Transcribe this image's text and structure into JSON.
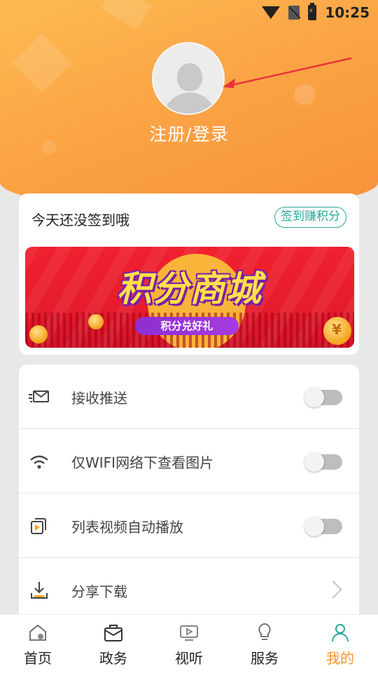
{
  "status_bar": {
    "time": "10:25",
    "icons": [
      "wifi-icon",
      "no-sim-icon",
      "battery-charging-icon"
    ]
  },
  "profile": {
    "avatar_icon": "default-avatar-icon",
    "login_label": "注册/登录"
  },
  "checkin": {
    "prompt": "今天还没签到哦",
    "button_label": "签到赚积分",
    "banner": {
      "title": "积分商城",
      "subtitle": "积分兑好礼"
    }
  },
  "settings": {
    "items": [
      {
        "icon": "mail-icon",
        "label": "接收推送",
        "type": "toggle",
        "on": false
      },
      {
        "icon": "wifi-icon",
        "label": "仅WIFI网络下查看图片",
        "type": "toggle",
        "on": false
      },
      {
        "icon": "video-list-icon",
        "label": "列表视频自动播放",
        "type": "toggle",
        "on": false
      },
      {
        "icon": "download-icon",
        "label": "分享下载",
        "type": "link"
      }
    ]
  },
  "bottom_nav": {
    "items": [
      {
        "icon": "home-icon",
        "label": "首页",
        "active": false
      },
      {
        "icon": "briefcase-icon",
        "label": "政务",
        "active": false
      },
      {
        "icon": "video-icon",
        "label": "视听",
        "active": false
      },
      {
        "icon": "lightbulb-icon",
        "label": "服务",
        "active": false
      },
      {
        "icon": "person-icon",
        "label": "我的",
        "active": true
      }
    ],
    "active_color": "#f5952e"
  },
  "colors": {
    "header_orange": "#fba546",
    "accent_teal": "#2aa79b",
    "active_orange": "#f5952e"
  }
}
